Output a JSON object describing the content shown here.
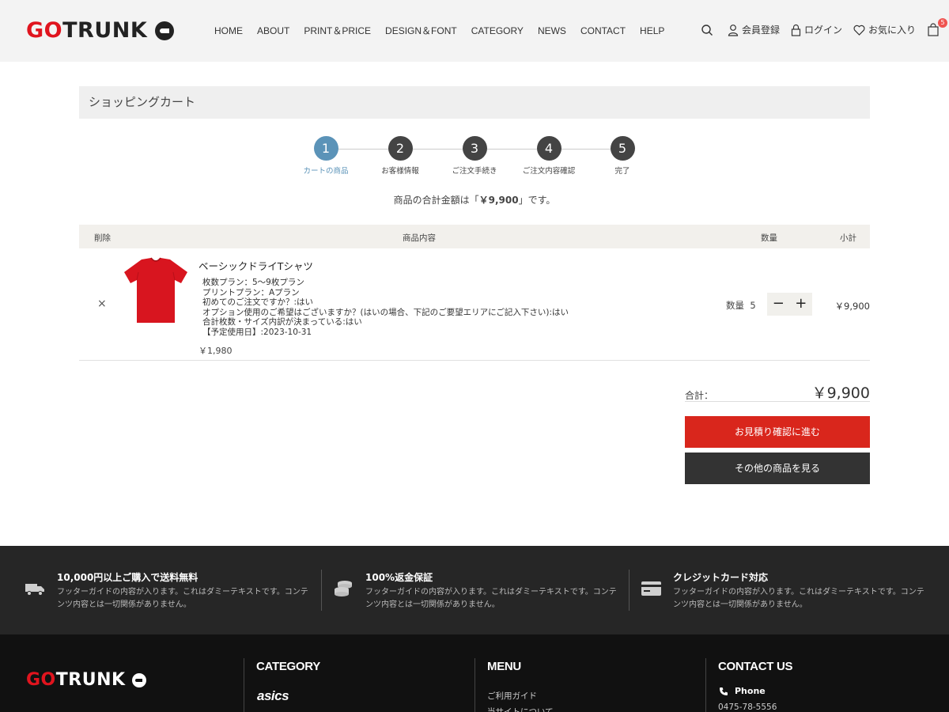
{
  "header": {
    "logo": {
      "text_red": "GO",
      "text_dark": "TRUNK"
    },
    "nav": [
      "HOME",
      "ABOUT",
      "PRINT＆PRICE",
      "DESIGN＆FONT",
      "CATEGORY",
      "NEWS",
      "CONTACT",
      "HELP"
    ],
    "register": "会員登録",
    "login": "ログイン",
    "favorites": "お気に入り",
    "cart_count": "5",
    "icons": [
      "search-icon",
      "user-icon",
      "lock-icon",
      "heart-icon",
      "cart-icon"
    ]
  },
  "page_title": "ショッピングカート",
  "steps": [
    {
      "num": "1",
      "label": "カートの商品"
    },
    {
      "num": "2",
      "label": "お客様情報"
    },
    {
      "num": "3",
      "label": "ご注文手続き"
    },
    {
      "num": "4",
      "label": "ご注文内容確認"
    },
    {
      "num": "5",
      "label": "完了"
    }
  ],
  "total_message": {
    "before": "商品の合計金額は「",
    "amount": "￥9,900",
    "after": "」です。"
  },
  "table": {
    "col_delete": "削除",
    "col_item": "商品内容",
    "col_qty": "数量",
    "col_subtotal": "小計"
  },
  "item": {
    "remove": "×",
    "name": "ベーシックドライTシャツ",
    "options": [
      "枚数プラン：5〜9枚プラン",
      "プリントプラン：Aプラン",
      "初めてのご注文ですか？:はい",
      "オプション使用のご希望はございますか？(はいの場合、下記のご要望エリアにご記入下さい):はい",
      "合計枚数・サイズ内訳が決まっている:はい",
      "【予定使用日】:2023-10-31"
    ],
    "unit_price": "￥1,980",
    "qty_label": "数量",
    "qty": "5",
    "minus": "−",
    "plus": "+",
    "subtotal": "￥9,900",
    "image_color": "#d8151f"
  },
  "summary": {
    "label": "合計：",
    "value": "￥9,900",
    "btn_primary": "お見積り確認に進む",
    "btn_secondary": "その他の商品を見る"
  },
  "features": [
    {
      "icon": "truck-icon",
      "title": "10,000円以上ご購入で送料無料",
      "text": "フッターガイドの内容が入ります。これはダミーテキストです。コンテンツ内容とは一切関係がありません。"
    },
    {
      "icon": "coins-icon",
      "title": "100%返金保証",
      "text": "フッターガイドの内容が入ります。これはダミーテキストです。コンテンツ内容とは一切関係がありません。"
    },
    {
      "icon": "credit-card-icon",
      "title": "クレジットカード対応",
      "text": "フッターガイドの内容が入ります。これはダミーテキストです。コンテンツ内容とは一切関係がありません。"
    }
  ],
  "footer": {
    "category_title": "CATEGORY",
    "category_brand": "asics",
    "menu_title": "MENU",
    "menu_links": [
      "ご利用ガイド",
      "当サイトについて"
    ],
    "contact_title": "CONTACT US",
    "phone_label": "Phone",
    "phone": "0475-78-5556"
  },
  "colors": {
    "brand_red": "#e0141e",
    "step_active": "#5b93b8",
    "button_red": "#d9261c",
    "button_dark": "#333333"
  }
}
